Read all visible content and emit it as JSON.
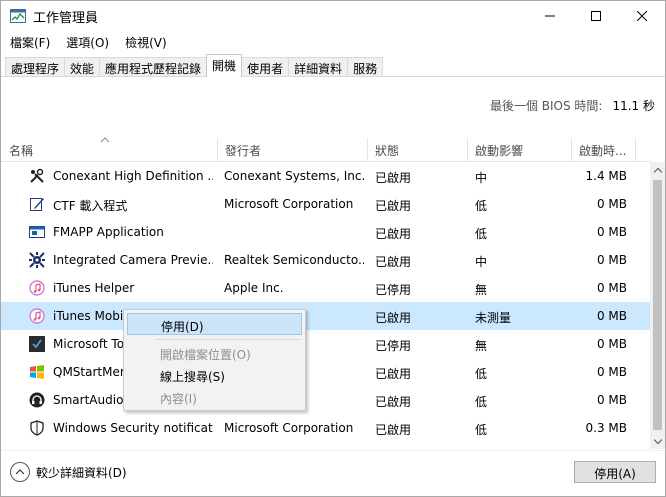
{
  "window": {
    "title": "工作管理員",
    "controls": {
      "minimize_icon": "minimize-icon",
      "maximize_icon": "maximize-icon",
      "close_icon": "close-icon"
    }
  },
  "menu": [
    "檔案(F)",
    "選項(O)",
    "檢視(V)"
  ],
  "tabs": [
    {
      "label": "處理程序",
      "active": false
    },
    {
      "label": "效能",
      "active": false
    },
    {
      "label": "應用程式歷程記錄",
      "active": false
    },
    {
      "label": "開機",
      "active": true
    },
    {
      "label": "使用者",
      "active": false
    },
    {
      "label": "詳細資料",
      "active": false
    },
    {
      "label": "服務",
      "active": false
    }
  ],
  "bios": {
    "label": "最後一個 BIOS 時間:",
    "value": "11.1 秒"
  },
  "columns": {
    "name": "名稱",
    "publisher": "發行者",
    "status": "狀態",
    "impact": "啟動影響",
    "io": "啟動時..."
  },
  "rows": [
    {
      "name": "Conexant High Definition ...",
      "publisher": "Conexant Systems, Inc.",
      "status": "已啟用",
      "impact": "中",
      "io": "1.4 MB",
      "icon": "tools-icon",
      "selected": false
    },
    {
      "name": "CTF 載入程式",
      "publisher": "Microsoft Corporation",
      "status": "已啟用",
      "impact": "低",
      "io": "0 MB",
      "icon": "pen-icon",
      "selected": false
    },
    {
      "name": "FMAPP Application",
      "publisher": "",
      "status": "已啟用",
      "impact": "低",
      "io": "0 MB",
      "icon": "window-app-icon",
      "selected": false
    },
    {
      "name": "Integrated Camera Previe...",
      "publisher": "Realtek Semiconducto...",
      "status": "已啟用",
      "impact": "中",
      "io": "0 MB",
      "icon": "camera-gear-icon",
      "selected": false
    },
    {
      "name": "iTunes Helper",
      "publisher": "Apple Inc.",
      "status": "已停用",
      "impact": "無",
      "io": "0 MB",
      "icon": "itunes-icon",
      "selected": false
    },
    {
      "name": "iTunes Mobi",
      "publisher": "",
      "status": "已啟用",
      "impact": "未測量",
      "io": "0 MB",
      "icon": "itunes-icon",
      "selected": true
    },
    {
      "name": "Microsoft To",
      "publisher": "orporation",
      "status": "已停用",
      "impact": "無",
      "io": "0 MB",
      "icon": "todo-icon",
      "selected": false
    },
    {
      "name": "QMStartMer",
      "publisher": "",
      "status": "已啟用",
      "impact": "低",
      "io": "0 MB",
      "icon": "windows-logo-icon",
      "selected": false
    },
    {
      "name": "SmartAudio",
      "publisher": "ems, Inc.",
      "status": "已啟用",
      "impact": "低",
      "io": "0 MB",
      "icon": "headphone-icon",
      "selected": false
    },
    {
      "name": "Windows Security notificat...",
      "publisher": "Microsoft Corporation",
      "status": "已啟用",
      "impact": "低",
      "io": "0.3 MB",
      "icon": "shield-icon",
      "selected": false
    }
  ],
  "context_menu": [
    {
      "label": "停用(D)",
      "enabled": true,
      "hover": true
    },
    {
      "label": "開啟檔案位置(O)",
      "enabled": false
    },
    {
      "label": "線上搜尋(S)",
      "enabled": true
    },
    {
      "label": "內容(I)",
      "enabled": false
    }
  ],
  "footer": {
    "fewer_details": "較少詳細資料(D)",
    "disable_button": "停用(A)"
  }
}
